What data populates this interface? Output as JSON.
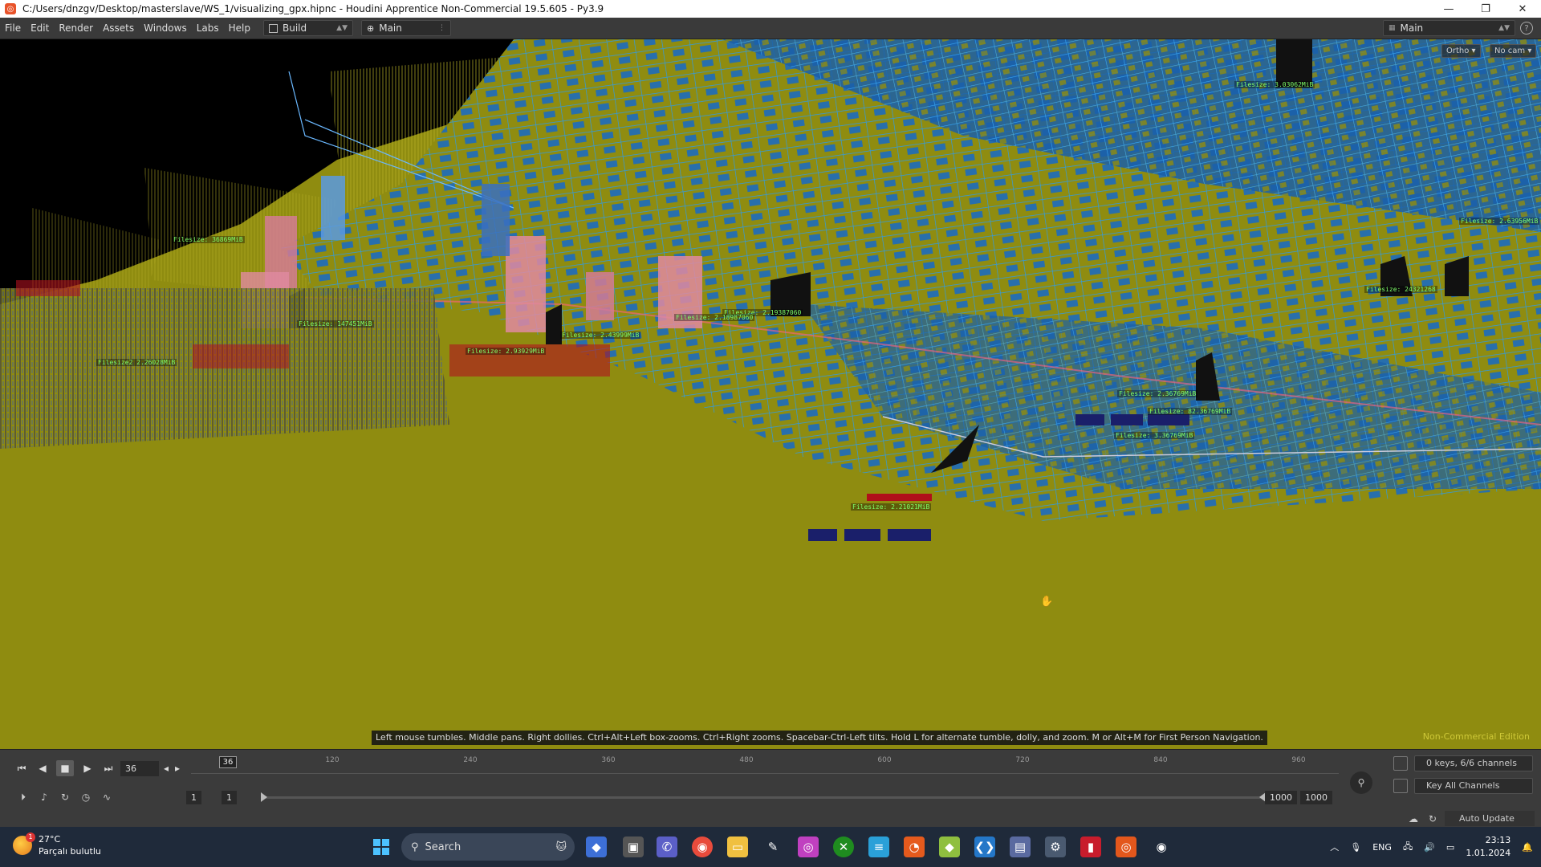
{
  "window": {
    "title": "C:/Users/dnzgv/Desktop/masterslave/WS_1/visualizing_gpx.hipnc - Houdini Apprentice Non-Commercial 19.5.605 - Py3.9",
    "minimize": "—",
    "maximize": "❐",
    "close": "✕"
  },
  "menu": {
    "items": [
      "File",
      "Edit",
      "Render",
      "Assets",
      "Windows",
      "Labs",
      "Help"
    ],
    "desktop_select": "Build",
    "network_select": "Main",
    "right_desktop": "Main",
    "help": "?"
  },
  "viewport": {
    "camera_button": "Ortho ▾",
    "cam_button": "No cam ▾",
    "hint": "Left mouse tumbles. Middle pans. Right dollies. Ctrl+Alt+Left box-zooms. Ctrl+Right zooms. Spacebar-Ctrl-Left tilts. Hold L for alternate tumble, dolly, and zoom.    M or Alt+M for First Person Navigation.",
    "watermark": "Non-Commercial Edition",
    "labels": [
      "Filesize: 3.03062MiB",
      "Filesize: 2.63956MiB",
      "Filesize: 24321268",
      "Filesize: 2.36769MiB",
      "Filesize: 82.36769MiB",
      "Filesize: 3.36769MiB",
      "Filesize: 2.21021MiB",
      "Filesize: 147451MiB",
      "Filesize: 2.43999MiB",
      "Filesize: 2.19387060",
      "Filesize2 2.26028MiB",
      "Filesize: 2.93929MiB",
      "Filesize: 36869MiB",
      "Filesize: 2.18987060"
    ],
    "colors": {
      "ground": "#8f8c10",
      "sky": "#000000",
      "grid_blue": "#2a8fd8",
      "label_green": "#7fff6a",
      "label_red": "#b0101a"
    }
  },
  "timeline": {
    "current_frame": "36",
    "playhead_label": "36",
    "ticks": [
      "120",
      "240",
      "360",
      "480",
      "600",
      "720",
      "840",
      "960"
    ],
    "range_start": "1",
    "range_start2": "1",
    "range_end": "1000",
    "range_end2": "1000",
    "keys_field": "0 keys, 6/6 channels",
    "key_all": "Key All Channels",
    "auto_update": "Auto Update"
  },
  "taskbar": {
    "weather_temp": "27°C",
    "weather_desc": "Parçalı bulutlu",
    "weather_badge": "1",
    "search": "Search",
    "lang": "ENG",
    "time": "23:13",
    "date": "1.01.2024"
  }
}
